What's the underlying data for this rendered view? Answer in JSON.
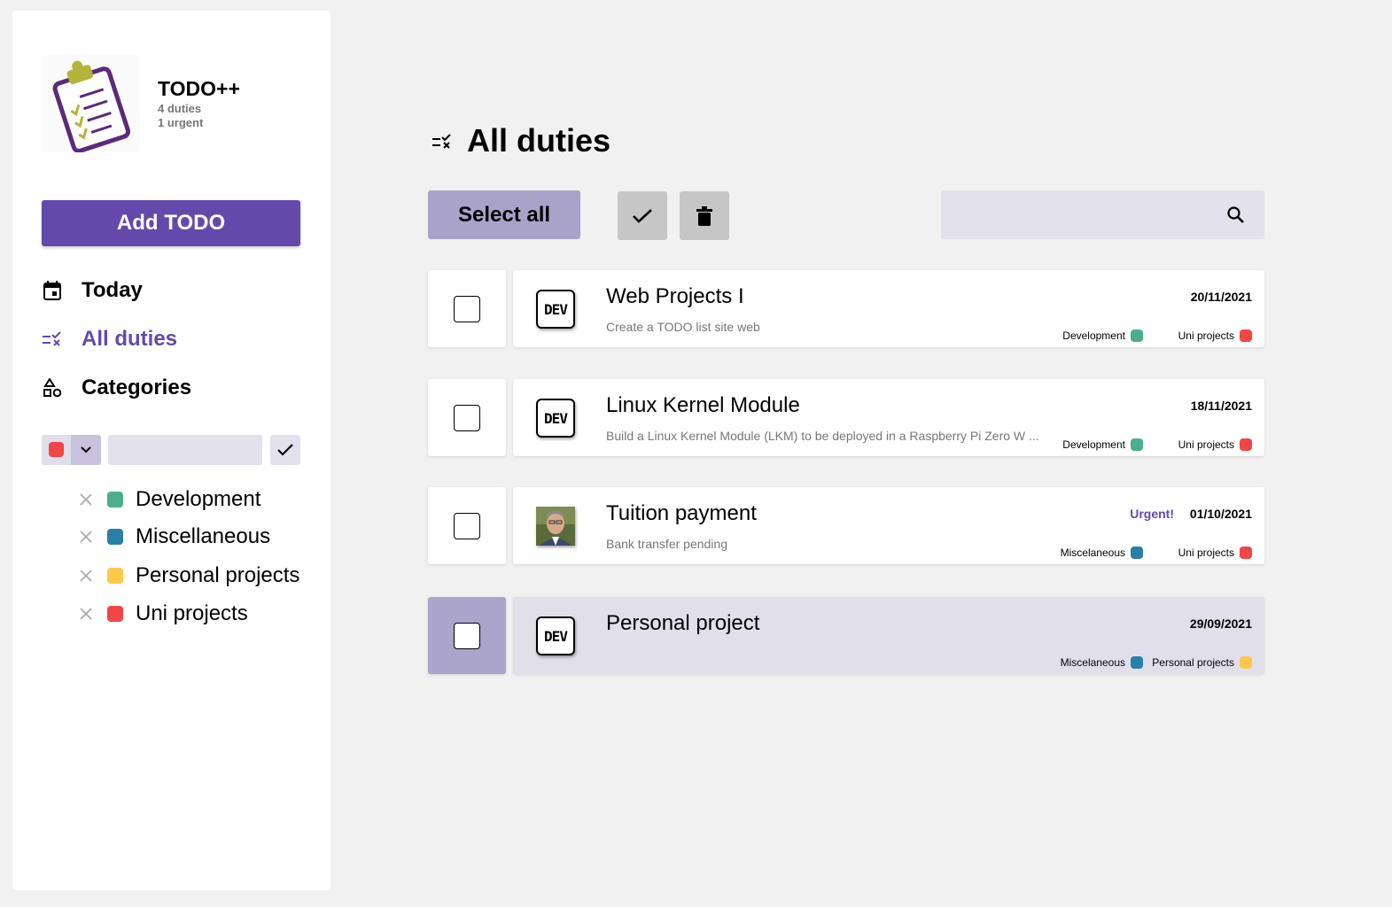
{
  "app": {
    "name": "TODO++",
    "duties_count": "4 duties",
    "urgent_count": "1 urgent",
    "logo_icon": "clipboard-checklist-icon"
  },
  "sidebar": {
    "add_label": "Add TODO",
    "nav": [
      {
        "label": "Today",
        "icon": "calendar-icon",
        "active": false
      },
      {
        "label": "All duties",
        "icon": "checklist-icon",
        "active": true
      },
      {
        "label": "Categories",
        "icon": "shapes-icon",
        "active": false
      }
    ],
    "category_form": {
      "selected_color": "#f04646",
      "name_value": "",
      "name_placeholder": ""
    },
    "categories": [
      {
        "label": "Development",
        "color": "#4caf8a"
      },
      {
        "label": "Miscellaneous",
        "color": "#2a7fa6"
      },
      {
        "label": "Personal projects",
        "color": "#ffc84a"
      },
      {
        "label": "Uni projects",
        "color": "#f04646"
      }
    ]
  },
  "main": {
    "title": "All duties",
    "select_all_label": "Select all",
    "search": {
      "value": "",
      "placeholder": ""
    },
    "todos": [
      {
        "title": "Web Projects I",
        "description": "Create a TODO list site web",
        "date": "20/11/2021",
        "urgent": "",
        "thumb": "dev-logo",
        "selected": false,
        "tags": [
          {
            "label": "Development",
            "color": "#4caf8a"
          },
          {
            "label": "Uni projects",
            "color": "#f04646"
          }
        ]
      },
      {
        "title": "Linux Kernel Module",
        "description": "Build a Linux Kernel Module (LKM) to be deployed in a Raspberry Pi Zero W ...",
        "date": "18/11/2021",
        "urgent": "",
        "thumb": "dev-logo",
        "selected": false,
        "tags": [
          {
            "label": "Development",
            "color": "#4caf8a"
          },
          {
            "label": "Uni projects",
            "color": "#f04646"
          }
        ]
      },
      {
        "title": "Tuition payment",
        "description": "Bank transfer pending",
        "date": "01/10/2021",
        "urgent": "Urgent!",
        "thumb": "person-photo",
        "selected": false,
        "tags": [
          {
            "label": "Miscelaneous",
            "color": "#2a7fa6"
          },
          {
            "label": "Uni projects",
            "color": "#f04646"
          }
        ]
      },
      {
        "title": "Personal project",
        "description": "",
        "date": "29/09/2021",
        "urgent": "",
        "thumb": "dev-logo",
        "selected": true,
        "tags": [
          {
            "label": "Miscelaneous",
            "color": "#2a7fa6"
          },
          {
            "label": "Personal projects",
            "color": "#ffc84a"
          }
        ]
      }
    ],
    "dev_logo_text": "DEV"
  }
}
